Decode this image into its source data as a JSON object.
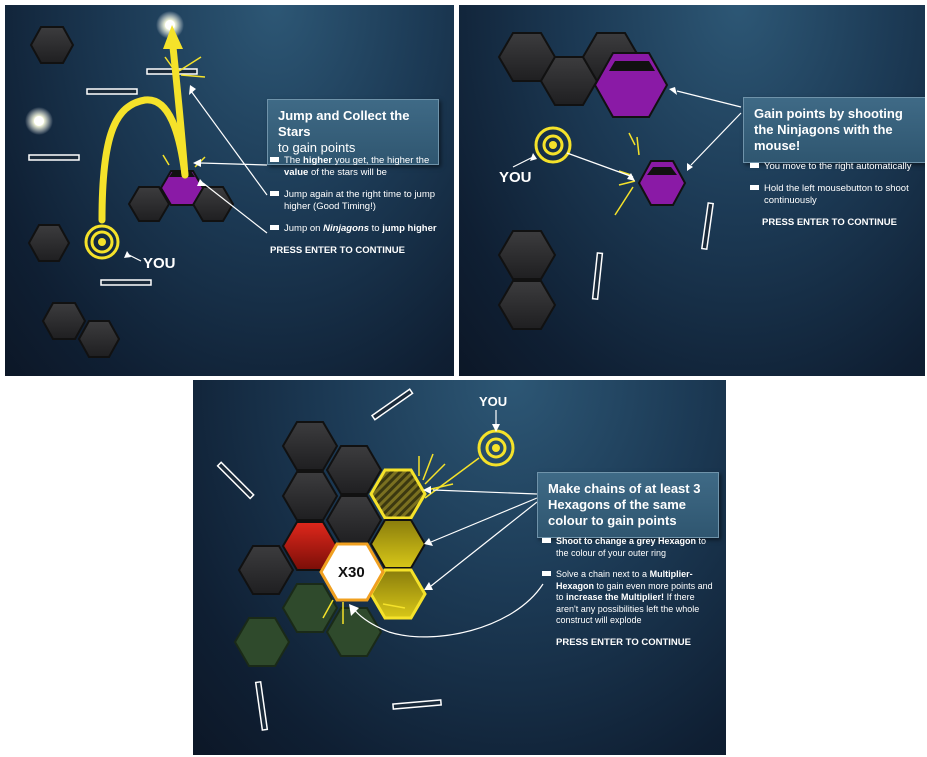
{
  "panel1": {
    "title": "Jump and Collect the Stars",
    "subtitle": "to gain points",
    "bullet1_pre": "The",
    "bullet1_bold1": "higher",
    "bullet1_mid": "you get, the higher the",
    "bullet1_bold2": "value",
    "bullet1_post": "of the stars will be",
    "bullet2": "Jump again at the right time to jump higher (Good Timing!)",
    "bullet3_pre": "Jump on",
    "bullet3_bold1": "Ninjagons",
    "bullet3_mid": "to",
    "bullet3_bold2": "jump higher",
    "press": "PRESS ENTER TO CONTINUE",
    "you": "YOU"
  },
  "panel2": {
    "title": "Gain points by shooting the Ninjagons with the mouse!",
    "bullet1": "You move to the right automatically",
    "bullet2": "Hold the left mousebutton to shoot continuously",
    "press": "PRESS ENTER TO CONTINUE",
    "you": "YOU"
  },
  "panel3": {
    "title": "Make chains of at least 3 Hexagons of the same colour to gain points",
    "bullet1_bold": "Shoot to change a grey Hexagon",
    "bullet1_rest": "to the colour of your outer ring",
    "bullet2_pre": "Solve a chain next to a",
    "bullet2_bold1": "Multiplier-Hexagon",
    "bullet2_mid": "to gain even more points and to",
    "bullet2_bold2": "increase the Multiplier!",
    "bullet2_post": "If there aren't any possibilities left the whole construct will explode",
    "press": "PRESS ENTER TO CONTINUE",
    "you": "YOU",
    "multiplier": "X30"
  },
  "colors": {
    "yellow": "#f5e22a",
    "purple": "#8a1aa6",
    "grey_hex": "#2e2e30",
    "red_hex": "#c0140e",
    "green_hex": "#2f4a2c",
    "panel_title_bg": "#2f5670"
  }
}
